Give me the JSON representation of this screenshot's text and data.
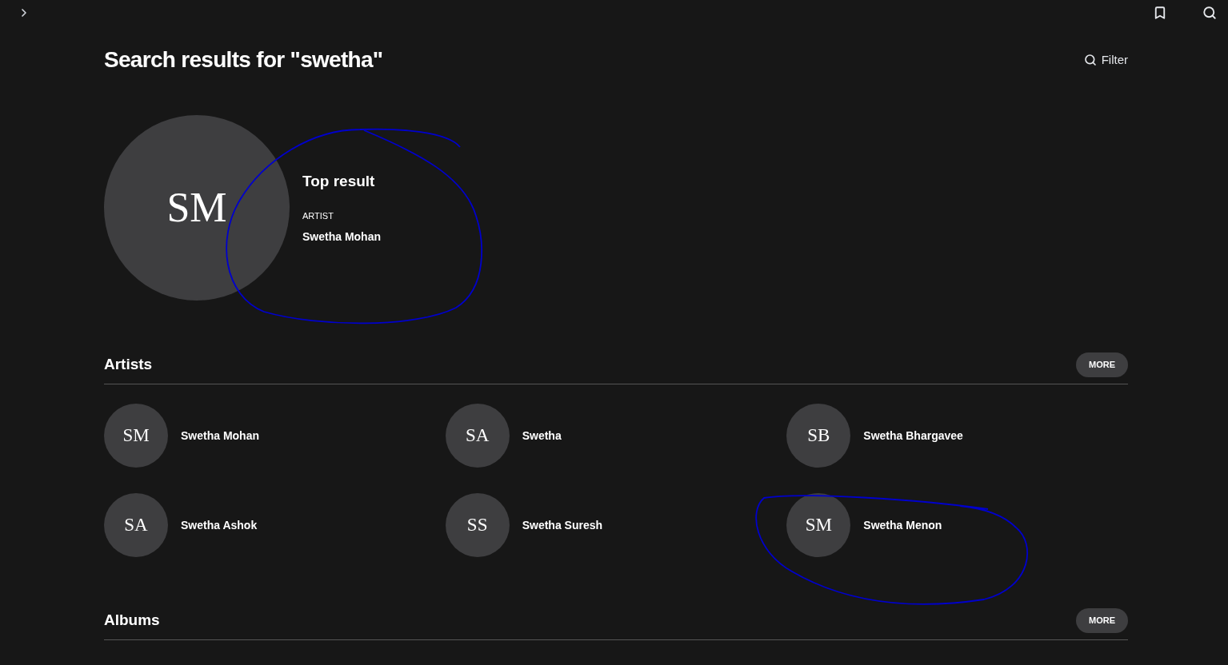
{
  "title": "Search results for \"swetha\"",
  "filter": {
    "label": "Filter"
  },
  "top_result": {
    "heading": "Top result",
    "initials": "SM",
    "type": "ARTIST",
    "name": "Swetha Mohan"
  },
  "sections": [
    {
      "title": "Artists",
      "more": "MORE",
      "items": [
        {
          "initials": "SM",
          "name": "Swetha Mohan"
        },
        {
          "initials": "SA",
          "name": "Swetha"
        },
        {
          "initials": "SB",
          "name": "Swetha Bhargavee"
        },
        {
          "initials": "SA",
          "name": "Swetha Ashok"
        },
        {
          "initials": "SS",
          "name": "Swetha Suresh"
        },
        {
          "initials": "SM",
          "name": "Swetha Menon"
        }
      ]
    },
    {
      "title": "Albums",
      "more": "MORE"
    }
  ]
}
